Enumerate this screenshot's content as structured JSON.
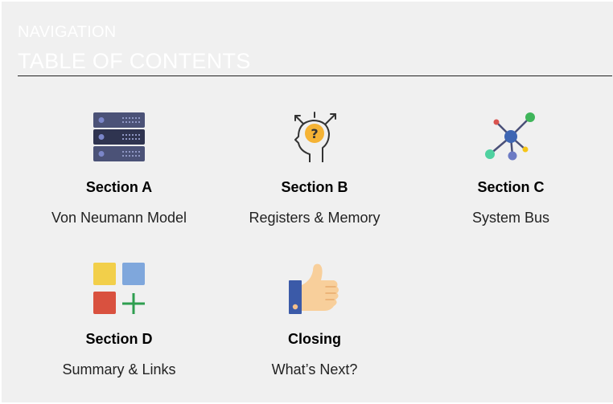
{
  "header": {
    "eyebrow": "NAVIGATION",
    "title": "TABLE OF CONTENTS"
  },
  "cards": [
    {
      "section": "Section A",
      "subtitle": "Von Neumann Model",
      "icon": "server-icon"
    },
    {
      "section": "Section B",
      "subtitle": "Registers & Memory",
      "icon": "thinking-head-icon"
    },
    {
      "section": "Section C",
      "subtitle": "System Bus",
      "icon": "network-icon"
    },
    {
      "section": "Section D",
      "subtitle": "Summary & Links",
      "icon": "add-tiles-icon"
    },
    {
      "section": "Closing",
      "subtitle": "What’s Next?",
      "icon": "thumbs-up-icon"
    }
  ],
  "colors": {
    "background": "#f0f0f0",
    "header_text": "#ffffff",
    "rule": "#222222"
  }
}
